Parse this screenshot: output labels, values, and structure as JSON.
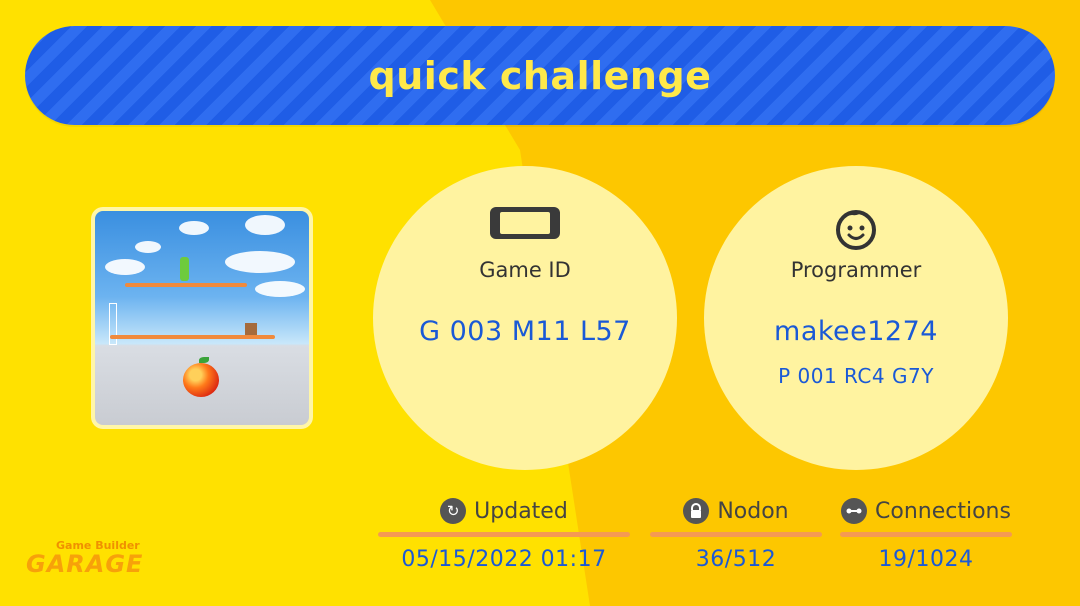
{
  "title": "quick challenge",
  "game": {
    "label": "Game ID",
    "id": "G 003 M11 L57",
    "icon": "console-icon"
  },
  "programmer": {
    "label": "Programmer",
    "name": "makee1274",
    "id": "P 001 RC4 G7Y",
    "icon": "face-icon"
  },
  "stats": {
    "updated": {
      "label": "Updated",
      "value": "05/15/2022 01:17",
      "icon": "refresh-icon"
    },
    "nodon": {
      "label": "Nodon",
      "value": "36/512",
      "icon": "lock-icon"
    },
    "connections": {
      "label": "Connections",
      "value": "19/1024",
      "icon": "link-icon"
    }
  },
  "logo": {
    "top": "Game Builder",
    "main": "GARAGE"
  },
  "colors": {
    "title_bar": "#2f6df0",
    "title_text": "#ffe94a",
    "value_text": "#1a59d6",
    "background": "#ffe100",
    "accent_bar": "#f59a52"
  }
}
